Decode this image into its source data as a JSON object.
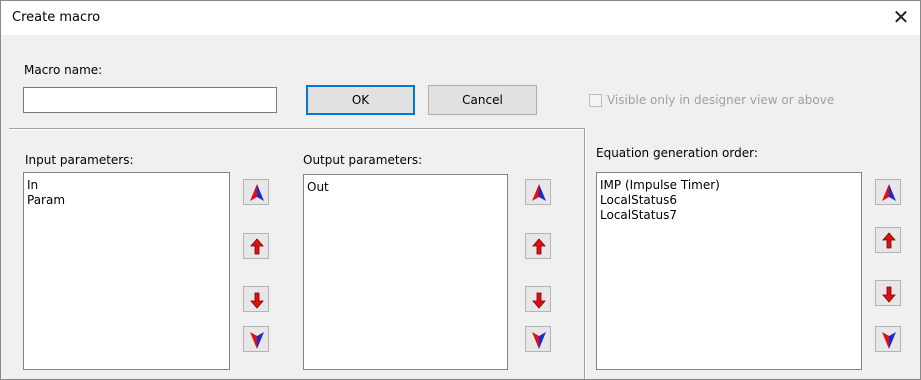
{
  "window": {
    "title": "Create macro",
    "close_glyph": "✕"
  },
  "macro": {
    "label": "Macro name:",
    "value": ""
  },
  "buttons": {
    "ok": "OK",
    "cancel": "Cancel"
  },
  "visible_option": {
    "label": "Visible only in designer view or above",
    "checked": false,
    "enabled": false
  },
  "input_params": {
    "label": "Input parameters:",
    "items": [
      "In",
      "Param"
    ]
  },
  "output_params": {
    "label": "Output parameters:",
    "items": [
      "Out"
    ]
  },
  "equation_order": {
    "label": "Equation generation order:",
    "items": [
      "IMP (Impulse Timer)",
      "LocalStatus6",
      "LocalStatus7"
    ]
  },
  "arrow_icons": [
    "move-to-top-icon",
    "move-up-icon",
    "move-down-icon",
    "move-to-bottom-icon"
  ],
  "colors": {
    "arrow_blue": "#1a2bd6",
    "arrow_red": "#e01010",
    "default_button_border": "#0078d7"
  }
}
